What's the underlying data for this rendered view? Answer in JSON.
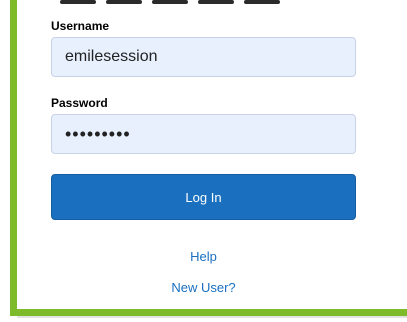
{
  "form": {
    "username_label": "Username",
    "username_value": "emilesession",
    "password_label": "Password",
    "password_value": "•••••••••",
    "login_label": "Log In"
  },
  "links": {
    "help": "Help",
    "new_user": "New User?"
  },
  "colors": {
    "frame_green": "#7dbb2b",
    "button_blue": "#1a6fbf",
    "input_bg": "#e8f0fe"
  }
}
